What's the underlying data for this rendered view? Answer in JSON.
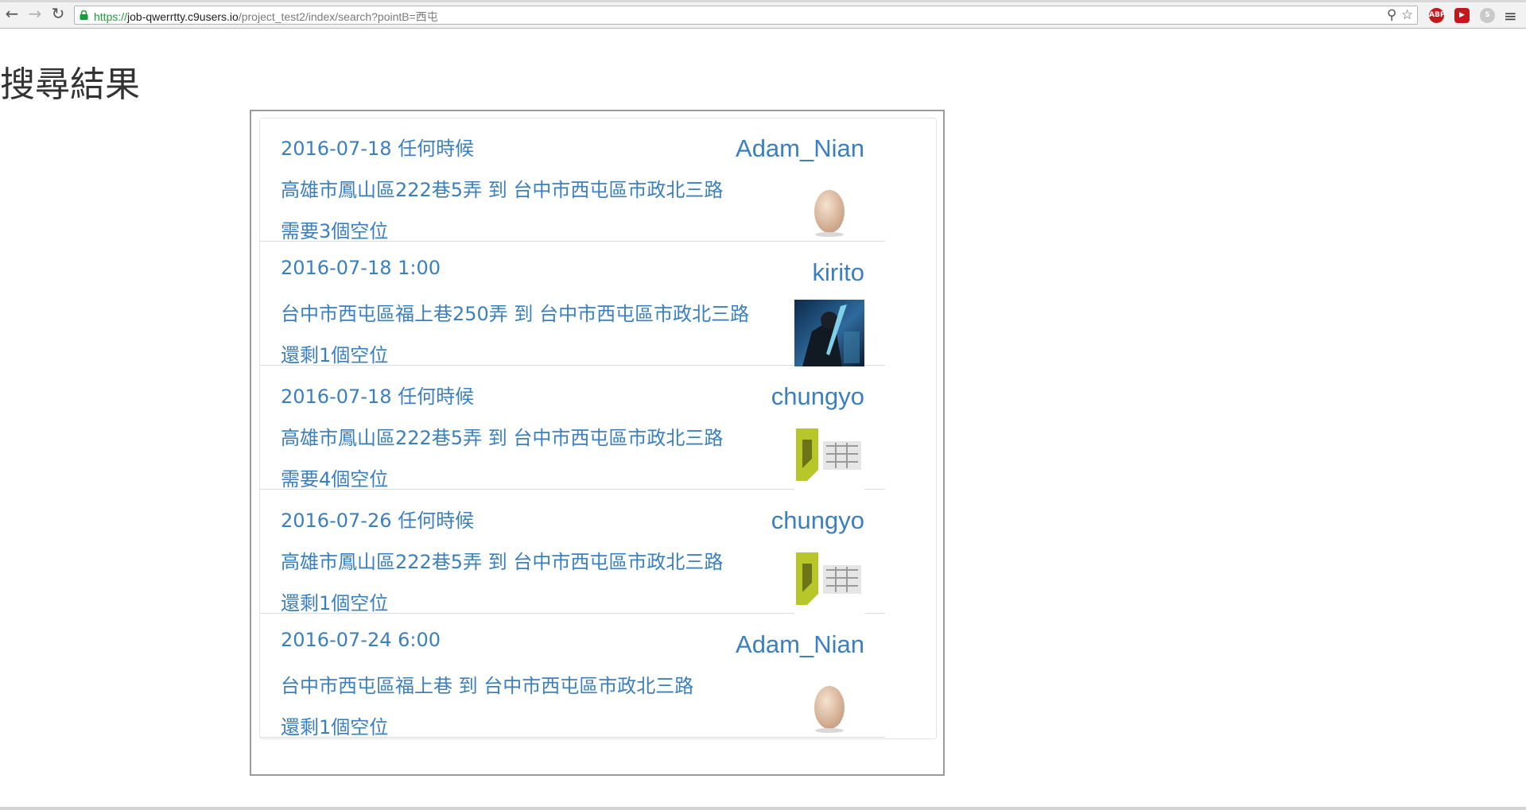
{
  "browser": {
    "url_scheme": "https://",
    "url_host": "job-qwerrtty.c9users.io",
    "url_path": "/project_test2/index/search?pointB=西屯",
    "back_icon": "back-arrow-icon",
    "forward_icon": "forward-arrow-icon",
    "reload_icon": "reload-icon",
    "lock_icon": "lock-icon",
    "zoom_icon": "zoom-icon",
    "bookmark_icon": "star-icon",
    "extensions": [
      {
        "name": "adblock-plus-icon",
        "label": "ABP"
      },
      {
        "name": "red-extension-icon",
        "label": ""
      },
      {
        "name": "skype-icon",
        "label": "S"
      }
    ],
    "menu_icon": "hamburger-menu-icon"
  },
  "page": {
    "title": "搜尋結果"
  },
  "results": [
    {
      "date": "2016-07-18 任何時候",
      "route": "高雄市鳳山區222巷5弄 到 台中市西屯區市政北三路",
      "seats": "需要3個空位",
      "user": "Adam_Nian",
      "avatar": "egg"
    },
    {
      "date": "2016-07-18 1:00",
      "route": "台中市西屯區福上巷250弄 到 台中市西屯區市政北三路",
      "seats": "還剩1個空位",
      "user": "kirito",
      "avatar": "anime"
    },
    {
      "date": "2016-07-18 任何時候",
      "route": "高雄市鳳山區222巷5弄 到 台中市西屯區市政北三路",
      "seats": "需要4個空位",
      "user": "chungyo",
      "avatar": "logo"
    },
    {
      "date": "2016-07-26 任何時候",
      "route": "高雄市鳳山區222巷5弄 到 台中市西屯區市政北三路",
      "seats": "還剩1個空位",
      "user": "chungyo",
      "avatar": "logo"
    },
    {
      "date": "2016-07-24 6:00",
      "route": "台中市西屯區福上巷 到 台中市西屯區市政北三路",
      "seats": "還剩1個空位",
      "user": "Adam_Nian",
      "avatar": "egg"
    }
  ],
  "colors": {
    "link": "#3a7fbe",
    "title": "#333333",
    "frame_border": "#9a9a9a"
  }
}
